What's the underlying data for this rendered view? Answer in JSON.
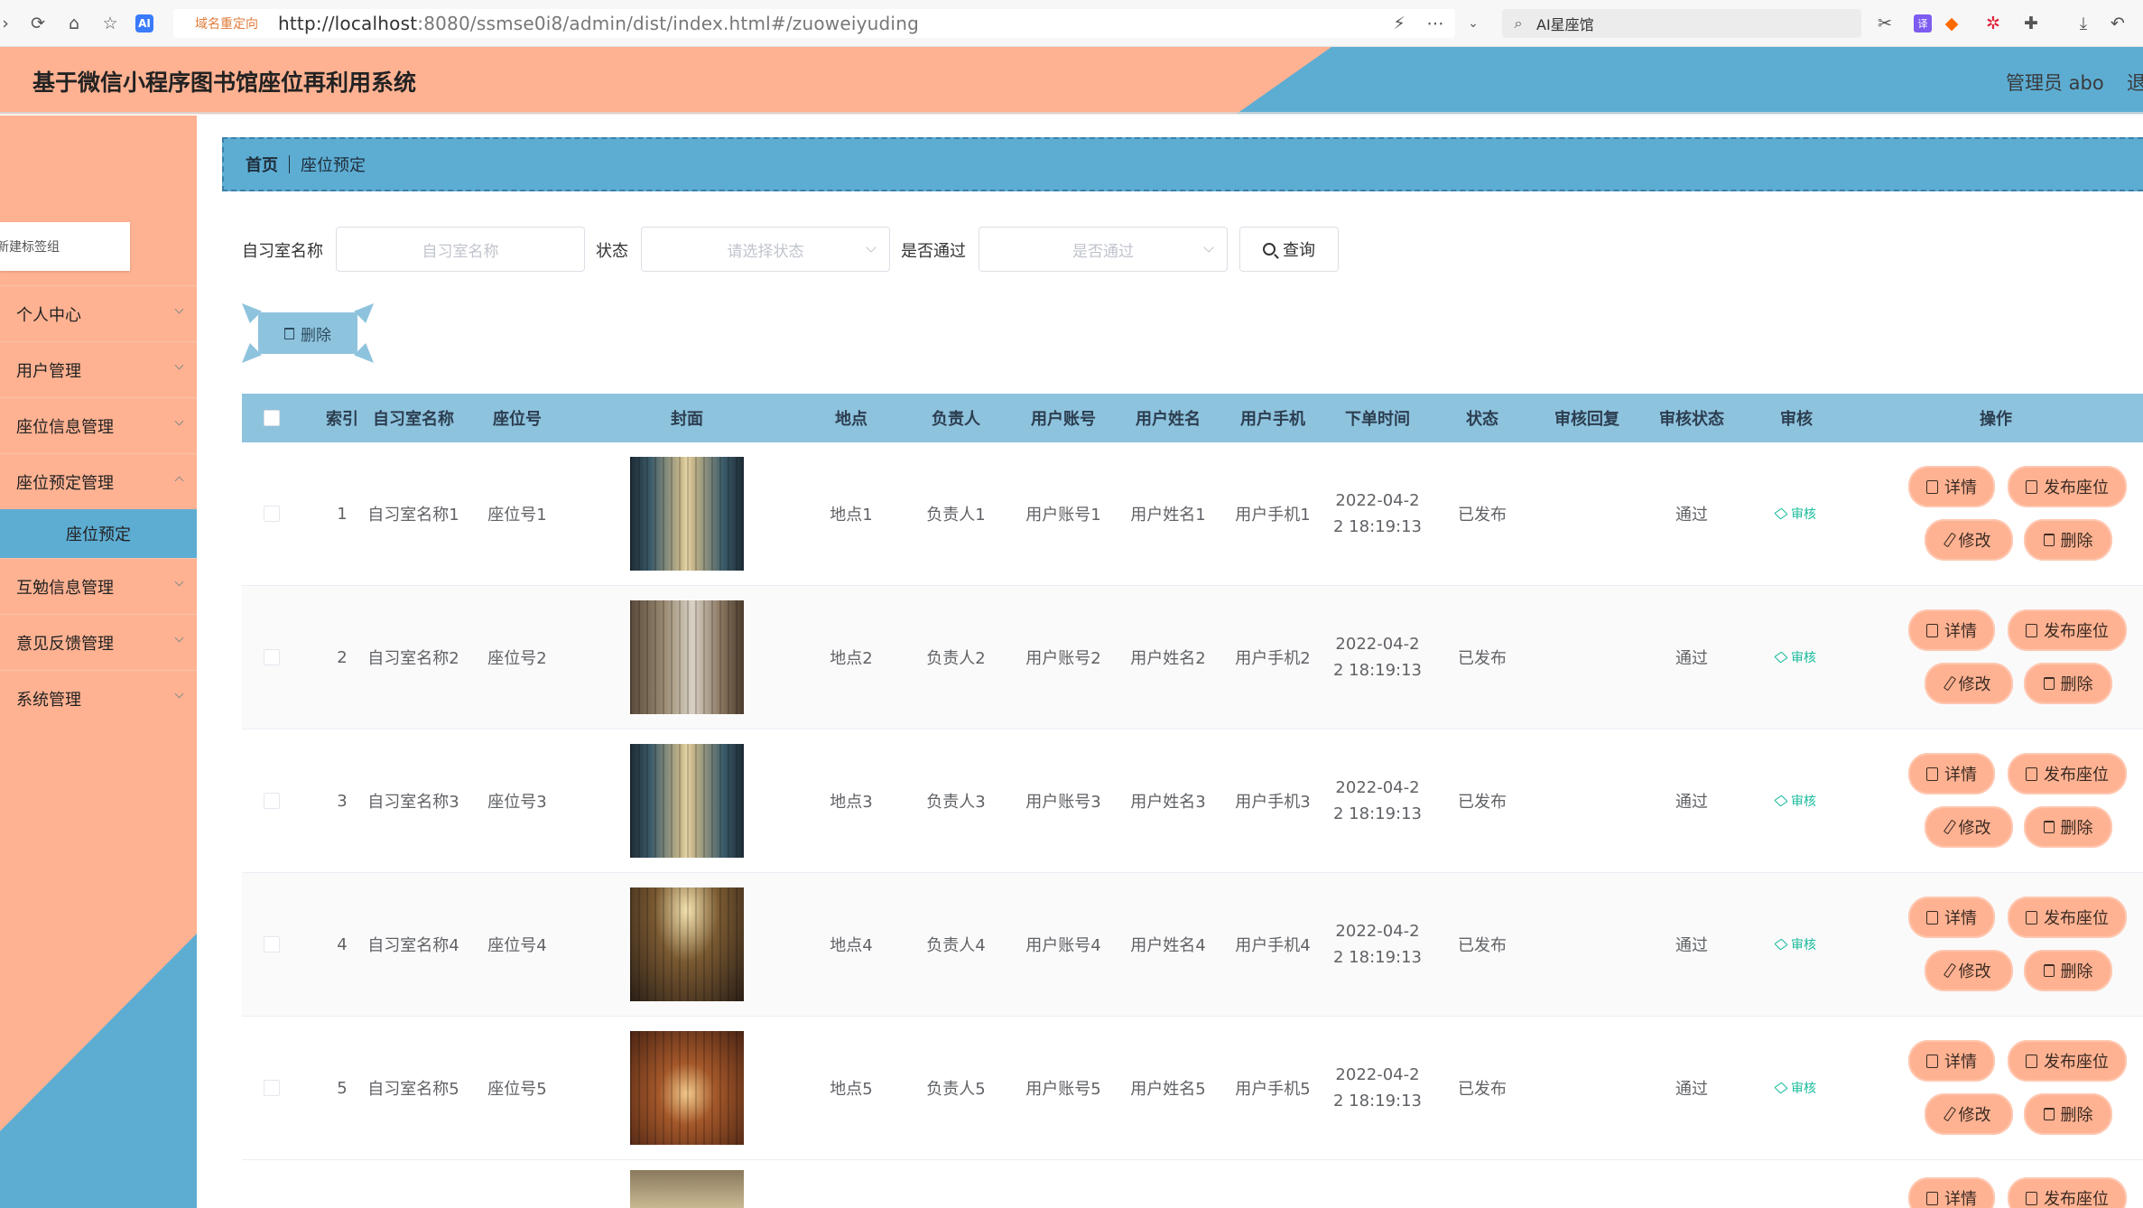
{
  "browser": {
    "redirect_tag": "域名重定向",
    "url_host": "http://localhost",
    "url_rest": ":8080/ssmse0i8/admin/dist/index.html#/zuoweiyuding",
    "search_text": "AI星座馆"
  },
  "header": {
    "title": "基于微信小程序图书馆座位再利用系统",
    "admin": "管理员 abo",
    "exit": "退"
  },
  "sidebar": {
    "tag_tab": "新建标签组",
    "items": [
      {
        "label": "个人中心"
      },
      {
        "label": "用户管理"
      },
      {
        "label": "座位信息管理"
      },
      {
        "label": "座位预定管理"
      },
      {
        "label": "互勉信息管理"
      },
      {
        "label": "意见反馈管理"
      },
      {
        "label": "系统管理"
      }
    ],
    "active_sub": "座位预定"
  },
  "breadcrumb": {
    "home": "首页",
    "current": "座位预定"
  },
  "filters": {
    "room_label": "自习室名称",
    "room_placeholder": "自习室名称",
    "status_label": "状态",
    "status_placeholder": "请选择状态",
    "pass_label": "是否通过",
    "pass_placeholder": "是否通过",
    "query": "查询"
  },
  "toolbar": {
    "delete": "删除"
  },
  "table": {
    "headers": [
      "索引",
      "自习室名称",
      "座位号",
      "封面",
      "地点",
      "负责人",
      "用户账号",
      "用户姓名",
      "用户手机",
      "下单时间",
      "状态",
      "审核回复",
      "审核状态",
      "审核",
      "操作"
    ],
    "rows": [
      {
        "index": "1",
        "room": "自习室名称1",
        "seat": "座位号1",
        "place": "地点1",
        "owner": "负责人1",
        "account": "用户账号1",
        "name": "用户姓名1",
        "phone": "用户手机1",
        "time_a": "2022-04-2",
        "time_b": "2 18:19:13",
        "status": "已发布",
        "reply": "",
        "audit_status": "通过",
        "audit": "审核"
      },
      {
        "index": "2",
        "room": "自习室名称2",
        "seat": "座位号2",
        "place": "地点2",
        "owner": "负责人2",
        "account": "用户账号2",
        "name": "用户姓名2",
        "phone": "用户手机2",
        "time_a": "2022-04-2",
        "time_b": "2 18:19:13",
        "status": "已发布",
        "reply": "",
        "audit_status": "通过",
        "audit": "审核"
      },
      {
        "index": "3",
        "room": "自习室名称3",
        "seat": "座位号3",
        "place": "地点3",
        "owner": "负责人3",
        "account": "用户账号3",
        "name": "用户姓名3",
        "phone": "用户手机3",
        "time_a": "2022-04-2",
        "time_b": "2 18:19:13",
        "status": "已发布",
        "reply": "",
        "audit_status": "通过",
        "audit": "审核"
      },
      {
        "index": "4",
        "room": "自习室名称4",
        "seat": "座位号4",
        "place": "地点4",
        "owner": "负责人4",
        "account": "用户账号4",
        "name": "用户姓名4",
        "phone": "用户手机4",
        "time_a": "2022-04-2",
        "time_b": "2 18:19:13",
        "status": "已发布",
        "reply": "",
        "audit_status": "通过",
        "audit": "审核"
      },
      {
        "index": "5",
        "room": "自习室名称5",
        "seat": "座位号5",
        "place": "地点5",
        "owner": "负责人5",
        "account": "用户账号5",
        "name": "用户姓名5",
        "phone": "用户手机5",
        "time_a": "2022-04-2",
        "time_b": "2 18:19:13",
        "status": "已发布",
        "reply": "",
        "audit_status": "通过",
        "audit": "审核"
      }
    ],
    "actions": {
      "detail": "详情",
      "publish": "发布座位",
      "edit": "修改",
      "delete": "删除"
    }
  },
  "colors": {
    "peach": "#ffb292",
    "blue": "#5dadd3",
    "light_blue": "#8ec3de",
    "audit_green": "#1abc9c"
  }
}
